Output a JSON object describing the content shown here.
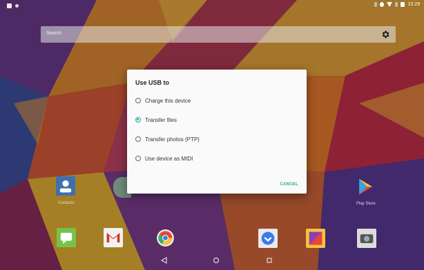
{
  "search": {
    "label": "Search"
  },
  "home": {
    "left_app_label": "Contacts",
    "right_app_label": "Play Store"
  },
  "dialog": {
    "title": "Use USB to",
    "options": [
      {
        "label": "Charge this device",
        "selected": false
      },
      {
        "label": "Transfer files",
        "selected": true
      },
      {
        "label": "Transfer photos (PTP)",
        "selected": false
      },
      {
        "label": "Use device as MIDI",
        "selected": false
      }
    ],
    "cancel_label": "CANCEL"
  },
  "status": {
    "time": "15:29"
  },
  "colors": {
    "accent": "#18a999",
    "dialog_bg": "#fafafa"
  },
  "nav": {
    "icons": [
      "back-icon",
      "home-icon",
      "recents-icon"
    ]
  }
}
